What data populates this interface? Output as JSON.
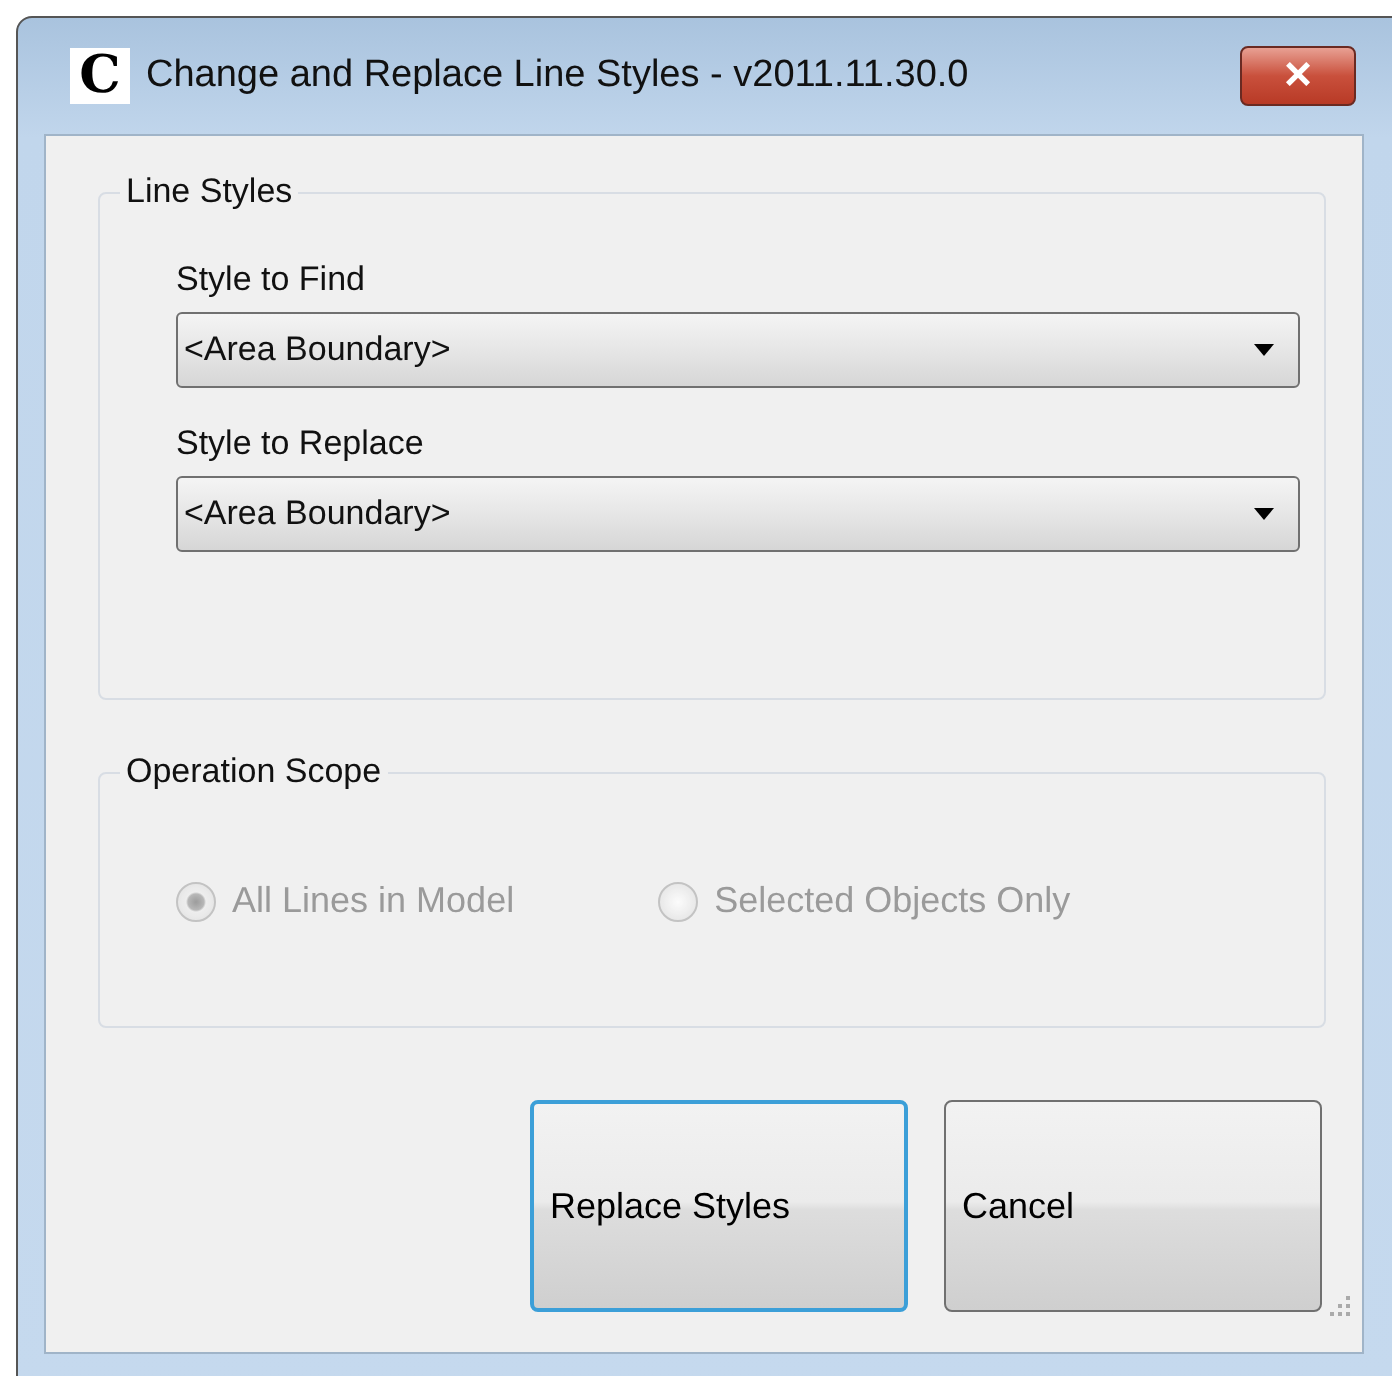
{
  "window": {
    "icon_letter": "C",
    "title": "Change and Replace Line Styles - v2011.11.30.0",
    "close": "×"
  },
  "line_styles": {
    "title": "Line Styles",
    "fields": [
      {
        "label": "Style to Find",
        "value": "<Area Boundary>"
      },
      {
        "label": "Style to Replace",
        "value": "<Area Boundary>"
      }
    ]
  },
  "operation_scope": {
    "title": "Operation Scope",
    "disabled": true,
    "options": [
      {
        "label": "All Lines in Model",
        "selected": true
      },
      {
        "label": "Selected Objects Only",
        "selected": false
      }
    ]
  },
  "buttons": [
    {
      "label": "Replace Styles",
      "default": true
    },
    {
      "label": "Cancel",
      "default": false
    }
  ]
}
